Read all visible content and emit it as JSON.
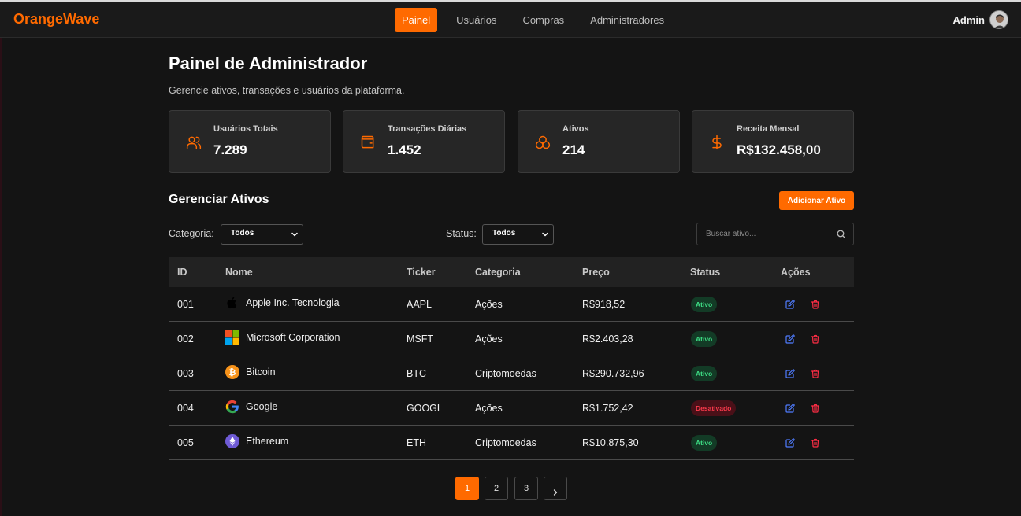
{
  "brand": "OrangeWave",
  "nav": {
    "items": [
      "Painel",
      "Usuários",
      "Compras",
      "Administradores"
    ],
    "active_index": 0
  },
  "user": {
    "name": "Admin"
  },
  "colors": {
    "accent": "#ff6a00",
    "active_badge": "#3ddc84",
    "inactive_badge": "#ff3b4d"
  },
  "page": {
    "title": "Painel de Administrador",
    "subtitle": "Gerencie ativos, transações e usuários da plataforma."
  },
  "stats": [
    {
      "label": "Usuários Totais",
      "value": "7.289",
      "icon": "users-icon"
    },
    {
      "label": "Transações Diárias",
      "value": "1.452",
      "icon": "wallet-icon"
    },
    {
      "label": "Ativos",
      "value": "214",
      "icon": "coins-icon"
    },
    {
      "label": "Receita Mensal",
      "value": "R$132.458,00",
      "icon": "dollar-icon"
    }
  ],
  "assets": {
    "title": "Gerenciar Ativos",
    "add_button": "Adicionar Ativo",
    "filters": {
      "category_label": "Categoria:",
      "category_value": "Todos",
      "status_label": "Status:",
      "status_value": "Todos",
      "search_placeholder": "Buscar ativo..."
    },
    "columns": [
      "ID",
      "Nome",
      "Ticker",
      "Categoria",
      "Preço",
      "Status",
      "Ações"
    ],
    "rows": [
      {
        "id": "001",
        "name": "Apple Inc. Tecnologia",
        "ticker": "AAPL",
        "category": "Ações",
        "price": "R$918,52",
        "status": "Ativo",
        "logo": "apple-logo"
      },
      {
        "id": "002",
        "name": "Microsoft Corporation",
        "ticker": "MSFT",
        "category": "Ações",
        "price": "R$2.403,28",
        "status": "Ativo",
        "logo": "microsoft-logo"
      },
      {
        "id": "003",
        "name": "Bitcoin",
        "ticker": "BTC",
        "category": "Criptomoedas",
        "price": "R$290.732,96",
        "status": "Ativo",
        "logo": "bitcoin-logo"
      },
      {
        "id": "004",
        "name": "Google",
        "ticker": "GOOGL",
        "category": "Ações",
        "price": "R$1.752,42",
        "status": "Desativado",
        "logo": "google-logo"
      },
      {
        "id": "005",
        "name": "Ethereum",
        "ticker": "ETH",
        "category": "Criptomoedas",
        "price": "R$10.875,30",
        "status": "Ativo",
        "logo": "ethereum-logo"
      }
    ]
  },
  "pagination": {
    "pages": [
      "1",
      "2",
      "3"
    ],
    "current": "1",
    "next_icon": "chevron-right-icon"
  }
}
